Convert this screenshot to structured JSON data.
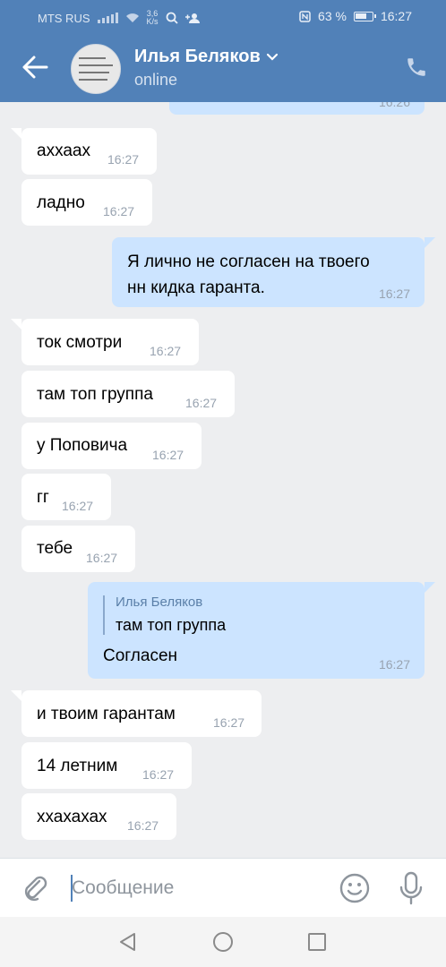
{
  "status_bar": {
    "carrier": "MTS RUS",
    "speed_value": "3,6",
    "speed_unit": "K/s",
    "battery": "63 %",
    "time": "16:27"
  },
  "header": {
    "contact_name": "Илья Беляков",
    "presence": "online"
  },
  "messages": [
    {
      "side": "out",
      "text": "",
      "time": "16:26"
    },
    {
      "side": "in",
      "text": "аххаах",
      "time": "16:27"
    },
    {
      "side": "in",
      "text": "ладно",
      "time": "16:27"
    },
    {
      "side": "out",
      "text": "Я лично не согласен на твоего нн кидка гаранта.",
      "line1": "Я лично не согласен на твоего",
      "line2": "нн кидка гаранта.",
      "time": "16:27"
    },
    {
      "side": "in",
      "text": "ток смотри",
      "time": "16:27"
    },
    {
      "side": "in",
      "text": "там топ группа",
      "time": "16:27"
    },
    {
      "side": "in",
      "text": "у Поповича",
      "time": "16:27"
    },
    {
      "side": "in",
      "text": "гг",
      "time": "16:27"
    },
    {
      "side": "in",
      "text": "тебе",
      "time": "16:27"
    },
    {
      "side": "out",
      "reply": {
        "author": "Илья Беляков",
        "text": "там топ группа"
      },
      "text": "Согласен",
      "time": "16:27"
    },
    {
      "side": "in",
      "text": "и твоим гарантам",
      "time": "16:27"
    },
    {
      "side": "in",
      "text": "14 летним",
      "time": "16:27"
    },
    {
      "side": "in",
      "text": "ххахахах",
      "time": "16:27"
    }
  ],
  "composer": {
    "placeholder": "Сообщение"
  },
  "colors": {
    "header": "#5181b8",
    "incoming_bubble": "#ffffff",
    "outgoing_bubble": "#cce4ff",
    "background": "#edeef0"
  },
  "icons": [
    "back-arrow-icon",
    "phone-icon",
    "chevron-down-icon",
    "paperclip-icon",
    "smile-icon",
    "microphone-icon",
    "nav-back-icon",
    "nav-home-icon",
    "nav-recent-icon"
  ]
}
